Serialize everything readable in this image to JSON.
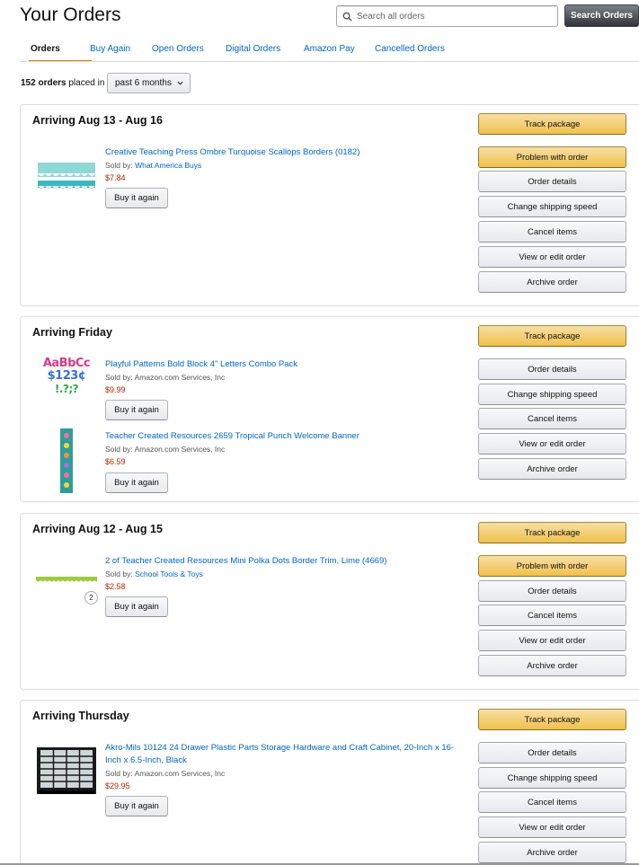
{
  "header": {
    "title": "Your Orders",
    "search_placeholder": "Search all orders",
    "search_button": "Search Orders"
  },
  "tabs": [
    "Orders",
    "Buy Again",
    "Open Orders",
    "Digital Orders",
    "Amazon Pay",
    "Cancelled Orders"
  ],
  "summary": {
    "count": "152 orders",
    "placed_in": " placed in",
    "period": "past 6 months"
  },
  "orders": [
    {
      "title": "Arriving Aug 13 - Aug 16",
      "actions": [
        "Track package",
        "Problem with order",
        "Order details",
        "Change shipping speed",
        "Cancel items",
        "View or edit order",
        "Archive order"
      ],
      "items": [
        {
          "name": "Creative Teaching Press Ombre Turquoise Scallops Borders (0182)",
          "sold_by_label": "Sold by: ",
          "seller": "What America Buys",
          "price": "$7.84",
          "buy_again": "Buy it again"
        }
      ]
    },
    {
      "title": "Arriving Friday",
      "actions": [
        "Track package",
        "Order details",
        "Change shipping speed",
        "Cancel items",
        "View or edit order",
        "Archive order"
      ],
      "items": [
        {
          "name": "Playful Patterns Bold Block 4\" Letters Combo Pack",
          "sold_by_label": "Sold by: ",
          "seller": "Amazon.com Services, Inc",
          "price": "$9.99",
          "buy_again": "Buy it again",
          "thumb_text_1": "AaBbCc",
          "thumb_text_2": "$123¢",
          "thumb_text_3": "!.?;?"
        },
        {
          "name": "Teacher Created Resources 2659 Tropical Punch Welcome Banner",
          "sold_by_label": "Sold by: ",
          "seller": "Amazon.com Services, Inc",
          "price": "$6.59",
          "buy_again": "Buy it again"
        }
      ]
    },
    {
      "title": "Arriving Aug 12 - Aug 15",
      "actions": [
        "Track package",
        "Problem with order",
        "Order details",
        "Cancel items",
        "View or edit order",
        "Archive order"
      ],
      "items": [
        {
          "name": "2 of Teacher Created Resources Mini Polka Dots Border Trim, Lime (4669)",
          "sold_by_label": "Sold by: ",
          "seller": "School Tools & Toys",
          "price": "$2.58",
          "buy_again": "Buy it again",
          "quantity": "2"
        }
      ]
    },
    {
      "title": "Arriving Thursday",
      "actions": [
        "Track package",
        "Order details",
        "Change shipping speed",
        "Cancel items",
        "View or edit order",
        "Archive order"
      ],
      "items": [
        {
          "name": "Akro-Mils 10124 24 Drawer Plastic Parts Storage Hardware and Craft Cabinet, 20-Inch x 16-Inch x 6.5-Inch, Black",
          "sold_by_label": "Sold by: ",
          "seller": "Amazon.com Services, Inc",
          "price": "$29.95",
          "buy_again": "Buy it again"
        }
      ]
    }
  ],
  "colors": {
    "link": "#0066c0",
    "price": "#b12704",
    "tab_accent": "#e77600",
    "primary_button": "#f0c14b"
  }
}
